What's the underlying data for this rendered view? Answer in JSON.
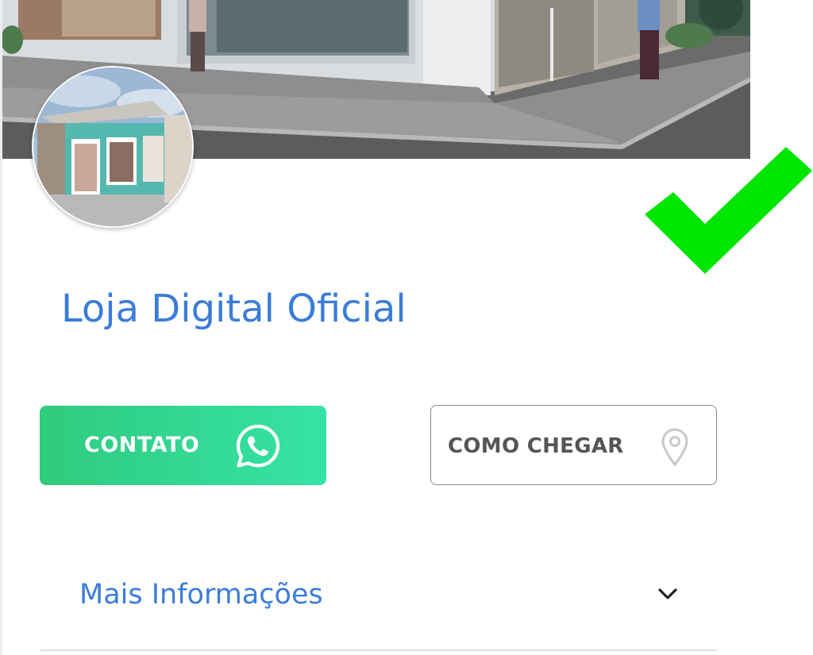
{
  "store": {
    "name": "Loja Digital Oficial"
  },
  "actions": {
    "contact_label": "CONTATO",
    "contact_icon": "whatsapp-icon",
    "directions_label": "COMO CHEGAR",
    "directions_icon": "map-pin-icon"
  },
  "info": {
    "more_label": "Mais Informações",
    "toggle_icon": "chevron-down-icon"
  },
  "colors": {
    "accent_blue": "#3b7dd8",
    "contact_green_start": "#2fcb7d",
    "contact_green_end": "#36e3a6",
    "check_green": "#00e600"
  }
}
